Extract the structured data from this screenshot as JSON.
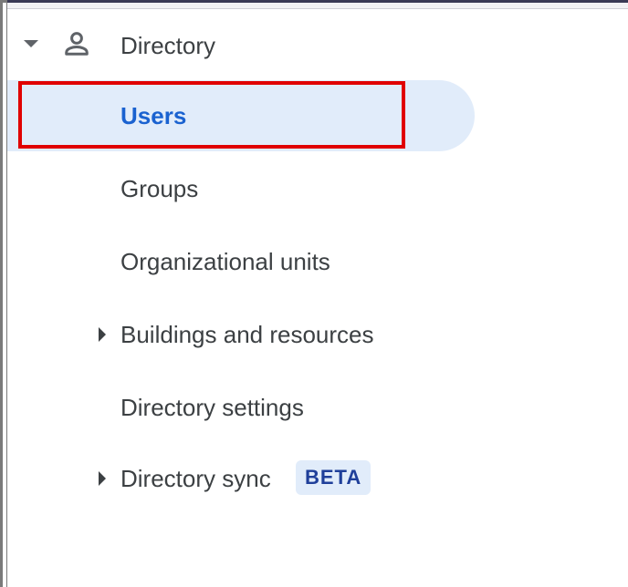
{
  "nav": {
    "section": {
      "label": "Directory",
      "icon": "person-icon",
      "expanded": true
    },
    "items": [
      {
        "label": "Users",
        "active": true
      },
      {
        "label": "Groups"
      },
      {
        "label": "Organizational units"
      },
      {
        "label": "Buildings and resources",
        "expandable": true
      },
      {
        "label": "Directory settings"
      },
      {
        "label": "Directory sync",
        "expandable": true,
        "badge": "BETA"
      }
    ]
  },
  "colors": {
    "accent": "#1a62d0",
    "active_bg": "#e1ecfa",
    "focus_outline": "#e00000",
    "text": "#3c4043",
    "badge_text": "#1f3f9a"
  }
}
